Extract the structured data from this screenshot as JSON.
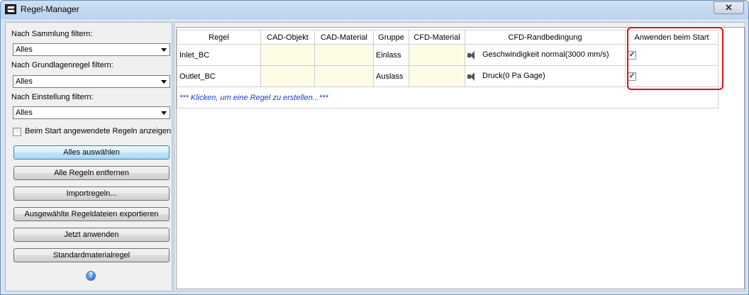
{
  "window": {
    "title": "Regel-Manager",
    "close_label": "✕"
  },
  "filters": {
    "sammlung_label": "Nach Sammlung filtern:",
    "sammlung_value": "Alles",
    "grundlagen_label": "Nach Grundlagenregel filtern:",
    "grundlagen_value": "Alles",
    "einstellung_label": "Nach Einstellung filtern:",
    "einstellung_value": "Alles",
    "show_start_rules_label": "Beim Start angewendete Regeln anzeigen"
  },
  "buttons": {
    "select_all": "Alles auswählen",
    "remove_all": "Alle Regeln entfernen",
    "import": "Importregeln...",
    "export": "Ausgewählte Regeldateien exportieren",
    "apply_now": "Jetzt anwenden",
    "standard_material": "Standardmaterialregel",
    "help": "?"
  },
  "grid": {
    "columns": [
      "Regel",
      "CAD-Objekt",
      "CAD-Material",
      "Gruppe",
      "CFD-Material",
      "CFD-Randbedingung",
      "Anwenden beim Start"
    ],
    "rows": [
      {
        "regel": "Inlet_BC",
        "cad_objekt": "",
        "cad_material": "",
        "gruppe": "Einlass",
        "cfd_material": "",
        "randbedingung": "Geschwindigkeit normal(3000 mm/s)",
        "checked": "✓"
      },
      {
        "regel": "Outlet_BC",
        "cad_objekt": "",
        "cad_material": "",
        "gruppe": "Auslass",
        "cfd_material": "",
        "randbedingung": "Druck(0 Pa Gage)",
        "checked": "✓"
      }
    ],
    "add_row_text": "*** Klicken, um eine Regel zu erstellen...***"
  },
  "colors": {
    "highlight": "#e01010",
    "add_row_text": "#1f3ec1",
    "empty_cell": "#fffce6"
  },
  "icons": {
    "app": "regel-manager-app-icon",
    "boundary": "speaker-icon",
    "help": "help-icon"
  }
}
